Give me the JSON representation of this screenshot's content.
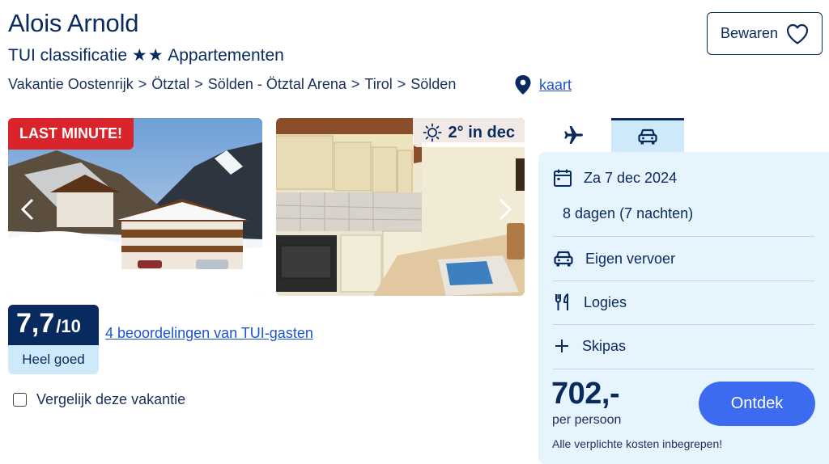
{
  "header": {
    "title": "Alois Arnold",
    "classification_prefix": "TUI classificatie",
    "stars": "★★",
    "accommodation_type": "Appartementen",
    "save_label": "Bewaren"
  },
  "breadcrumb": {
    "items": [
      "Vakantie Oostenrijk",
      "Ötztal",
      "Sölden - Ötztal Arena",
      "Tirol",
      "Sölden"
    ],
    "separator": ">",
    "map_label": "kaart"
  },
  "gallery": {
    "badge": "LAST MINUTE!",
    "weather": "2° in dec"
  },
  "rating": {
    "score": "7,7",
    "max": "/10",
    "verdict": "Heel goed",
    "reviews_link": "4 beoordelingen van TUI-gasten"
  },
  "compare": {
    "label": "Vergelijk deze vakantie"
  },
  "panel": {
    "date": "Za 7 dec 2024",
    "duration": "8 dagen (7 nachten)",
    "transport": "Eigen vervoer",
    "board": "Logies",
    "extra": "Skipas",
    "price": "702,-",
    "price_unit": "per persoon",
    "price_note": "Alle verplichte kosten inbegrepen!",
    "cta": "Ontdek"
  },
  "colors": {
    "navy": "#092a5e",
    "link": "#1e56c7",
    "last_minute": "#d9242b",
    "panel_bg": "#e6f4fd",
    "cta": "#3d6bf0"
  }
}
